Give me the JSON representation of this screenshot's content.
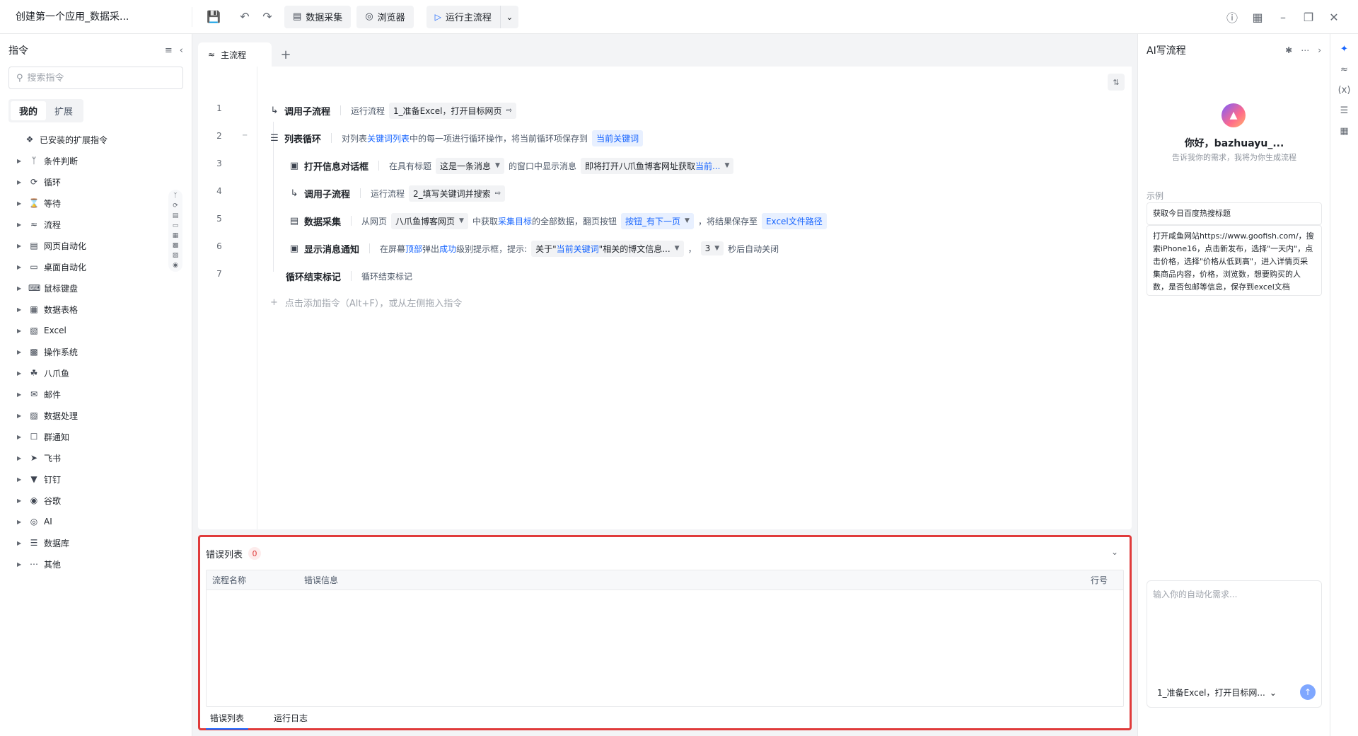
{
  "app": {
    "title": "创建第一个应用_数据采..."
  },
  "toolbar": {
    "save_icon": "save-icon",
    "undo_icon": "undo-icon",
    "redo_icon": "redo-icon",
    "data_collect_label": "数据采集",
    "browser_label": "浏览器",
    "run_label": "运行主流程",
    "right_icons": [
      "help-icon",
      "grid-icon",
      "minimize-icon",
      "restore-icon",
      "close-icon"
    ]
  },
  "left": {
    "title": "指令",
    "search_placeholder": "搜索指令",
    "tab_mine": "我的",
    "tab_ext": "扩展",
    "installed": "已安装的扩展指令",
    "items": [
      {
        "label": "条件判断",
        "icon": "branch-icon"
      },
      {
        "label": "循环",
        "icon": "loop-icon"
      },
      {
        "label": "等待",
        "icon": "hourglass-icon"
      },
      {
        "label": "流程",
        "icon": "flow-icon"
      },
      {
        "label": "网页自动化",
        "icon": "browser-icon"
      },
      {
        "label": "桌面自动化",
        "icon": "desktop-icon"
      },
      {
        "label": "鼠标键盘",
        "icon": "keyboard-icon"
      },
      {
        "label": "数据表格",
        "icon": "table-icon"
      },
      {
        "label": "Excel",
        "icon": "excel-icon"
      },
      {
        "label": "操作系统",
        "icon": "os-icon"
      },
      {
        "label": "八爪鱼",
        "icon": "octopus-icon"
      },
      {
        "label": "邮件",
        "icon": "mail-icon"
      },
      {
        "label": "数据处理",
        "icon": "data-process-icon"
      },
      {
        "label": "群通知",
        "icon": "chat-icon"
      },
      {
        "label": "飞书",
        "icon": "feishu-icon"
      },
      {
        "label": "钉钉",
        "icon": "dingtalk-icon"
      },
      {
        "label": "谷歌",
        "icon": "google-icon"
      },
      {
        "label": "AI",
        "icon": "ai-icon"
      },
      {
        "label": "数据库",
        "icon": "database-icon"
      },
      {
        "label": "其他",
        "icon": "more-icon"
      }
    ]
  },
  "editor": {
    "tab_label": "主流程",
    "lines": [
      "1",
      "2",
      "3",
      "4",
      "5",
      "6",
      "7"
    ],
    "steps": [
      {
        "cmd": "调用子流程",
        "pre": "运行流程",
        "chip": "1_准备Excel，打开目标网页"
      },
      {
        "cmd": "列表循环",
        "t1": "对列表",
        "k1": "关键词列表",
        "t2": "中的每一项进行循环操作，将当前循环项保存到",
        "chip": "当前关键词"
      },
      {
        "cmd": "打开信息对话框",
        "t1": "在具有标题",
        "chip1": "这是一条消息",
        "t2": "的窗口中显示消息",
        "chip2a": "即将打开八爪鱼博客网址获取",
        "chip2b": "当前..."
      },
      {
        "cmd": "调用子流程",
        "pre": "运行流程",
        "chip": "2_填写关键词并搜索"
      },
      {
        "cmd": "数据采集",
        "t1": "从网页",
        "chip1": "八爪鱼博客网页",
        "t2": "中获取",
        "k1": "采集目标",
        "t3": "的全部数据，翻页按钮",
        "chip2": "按钮_有下一页",
        "t4": "，将结果保存至",
        "chip3": "Excel文件路径"
      },
      {
        "cmd": "显示消息通知",
        "t1": "在屏幕",
        "k1": "顶部",
        "t2": "弹出",
        "k2": "成功",
        "t3": "级别提示框，提示:",
        "chip1a": "关于\"",
        "chip1b": "当前关键词",
        "chip1c": "\"相关的博文信息...",
        "sep": "，",
        "chip2": "3",
        "t4": "秒后自动关闭"
      },
      {
        "cmd": "循环结束标记",
        "t1": "循环结束标记"
      }
    ],
    "add_hint": "点击添加指令（Alt+F），或从左侧拖入指令"
  },
  "errors": {
    "title": "错误列表",
    "count": "0",
    "col_flow": "流程名称",
    "col_msg": "错误信息",
    "col_line": "行号",
    "tab_errors": "错误列表",
    "tab_log": "运行日志"
  },
  "ai": {
    "title": "AI写流程",
    "greeting": "你好，bazhuayu_...",
    "subtitle": "告诉我你的需求，我将为你生成流程",
    "example_label": "示例",
    "example1": "获取今日百度热搜标题",
    "example2": "打开咸鱼网站https://www.goofish.com/，搜索iPhone16，点击新发布，选择\"一天内\"，点击价格，选择\"价格从低到高\"，进入详情页采集商品内容，价格，浏览数，想要购买的人数，是否包邮等信息，保存到excel文档",
    "input_placeholder": "输入你的自动化需求...",
    "flow_select": "1_准备Excel，打开目标网..."
  }
}
